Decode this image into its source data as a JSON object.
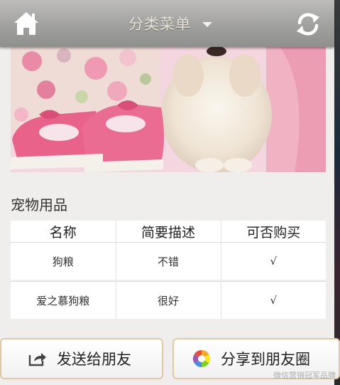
{
  "header": {
    "title": "分类菜单"
  },
  "section": {
    "title": "宠物用品"
  },
  "table": {
    "headers": [
      "名称",
      "简要描述",
      "可否购买"
    ],
    "rows": [
      [
        "狗粮",
        "不错",
        "√"
      ],
      [
        "爱之慕狗粮",
        "很好",
        "√"
      ]
    ]
  },
  "actions": {
    "send_label": "发送给朋友",
    "share_label": "分享到朋友圈"
  },
  "watermark": "微信营销冠军品牌",
  "colors": {
    "header": "#a3a3a1",
    "button_border": "#e2c7a7",
    "title_text": "#e8e4d8"
  }
}
